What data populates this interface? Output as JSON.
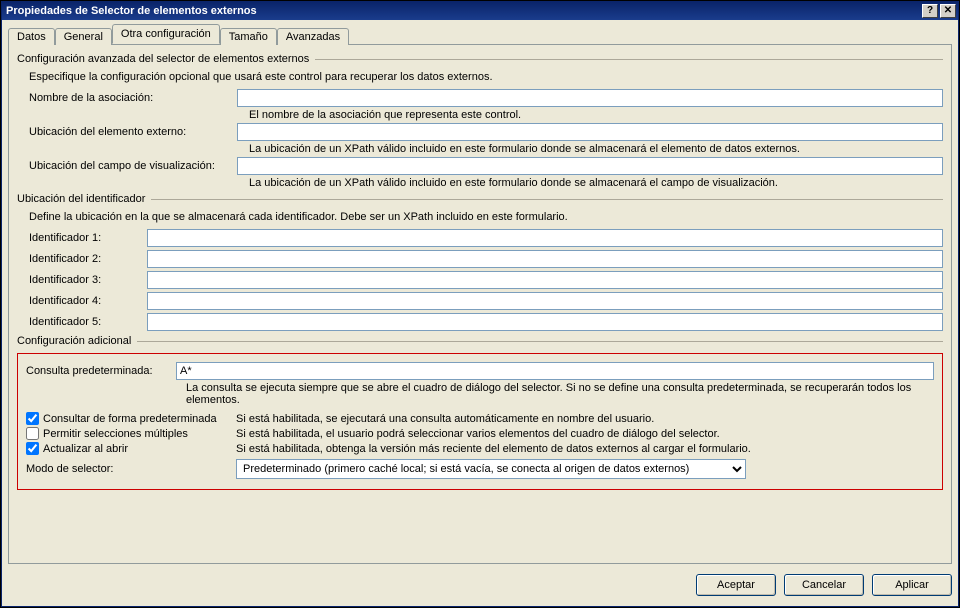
{
  "window": {
    "title": "Propiedades de Selector de elementos externos"
  },
  "tabs": {
    "items": [
      {
        "label": "Datos"
      },
      {
        "label": "General"
      },
      {
        "label": "Otra configuración",
        "active": true
      },
      {
        "label": "Tamaño"
      },
      {
        "label": "Avanzadas"
      }
    ]
  },
  "group_advanced": {
    "legend": "Configuración avanzada del selector de elementos externos",
    "desc": "Especifique la configuración opcional que usará este control para recuperar los datos externos.",
    "assoc_label": "Nombre de la asociación:",
    "assoc_value": "",
    "assoc_help": "El nombre de la asociación que representa este control.",
    "ext_loc_label": "Ubicación del elemento externo:",
    "ext_loc_value": "",
    "ext_loc_help": "La ubicación de un XPath válido incluido en este formulario donde se almacenará el elemento de datos externos.",
    "disp_loc_label": "Ubicación del campo de visualización:",
    "disp_loc_value": "",
    "disp_loc_help": "La ubicación de un XPath válido incluido en este formulario donde se almacenará el campo de visualización."
  },
  "group_ids": {
    "legend": "Ubicación del identificador",
    "desc": "Define la ubicación en la que se almacenará cada identificador. Debe ser un XPath incluido en este formulario.",
    "rows": [
      {
        "label": "Identificador 1:",
        "value": ""
      },
      {
        "label": "Identificador 2:",
        "value": ""
      },
      {
        "label": "Identificador 3:",
        "value": ""
      },
      {
        "label": "Identificador 4:",
        "value": ""
      },
      {
        "label": "Identificador 5:",
        "value": ""
      }
    ]
  },
  "group_add": {
    "legend": "Configuración adicional",
    "default_query_label": "Consulta predeterminada:",
    "default_query_value": "A*",
    "default_query_help": "La consulta se ejecuta siempre que se abre el cuadro de diálogo del selector. Si no se define una consulta predeterminada, se recuperarán todos los elementos.",
    "chk_query_default": {
      "label": "Consultar de forma predeterminada",
      "checked": true,
      "help": "Si está habilitada, se ejecutará una consulta automáticamente en nombre del usuario."
    },
    "chk_multi": {
      "label": "Permitir selecciones múltiples",
      "checked": false,
      "help": "Si está habilitada, el usuario podrá seleccionar varios elementos del cuadro de diálogo del selector."
    },
    "chk_refresh": {
      "label": "Actualizar al abrir",
      "checked": true,
      "help": "Si está habilitada, obtenga la versión más reciente del elemento de datos externos al cargar el formulario."
    },
    "selector_mode_label": "Modo de selector:",
    "selector_mode_value": "Predeterminado (primero caché local; si está vacía, se conecta al origen de datos externos)"
  },
  "buttons": {
    "ok": "Aceptar",
    "cancel": "Cancelar",
    "apply": "Aplicar"
  }
}
